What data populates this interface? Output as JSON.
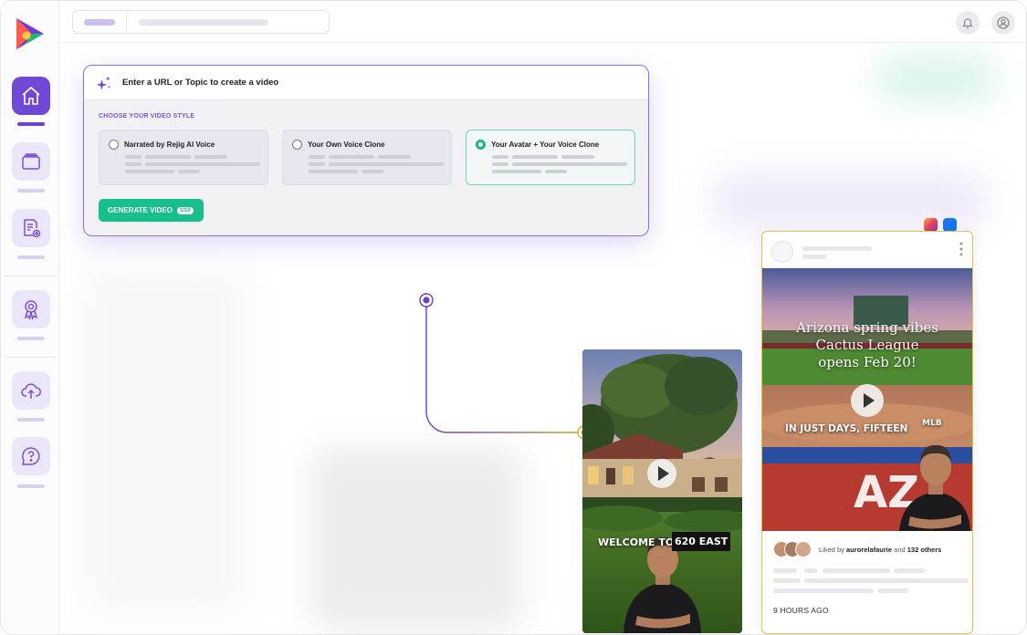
{
  "prompt": {
    "title": "Enter a URL or Topic to create a video",
    "style_label": "CHOOSE YOUR VIDEO STYLE",
    "options": [
      {
        "label": "Narrated by Rejig AI Voice",
        "selected": false
      },
      {
        "label": "Your Own Voice Clone",
        "selected": false
      },
      {
        "label": "Your Avatar + Your Voice Clone",
        "selected": true
      }
    ],
    "generate_label": "GENERATE VIDEO",
    "generate_count": "1/10"
  },
  "video": {
    "overlay_a": "WELCOME TO",
    "overlay_b": "620 EAST"
  },
  "post": {
    "caption_line1": "Arizona spring vibes",
    "caption_line2": "Cactus League",
    "caption_line3": "opens Feb 20!",
    "overlay_a": "IN JUST DAYS, FIFTEEN",
    "overlay_b": "MLB",
    "liked_prefix": "Liked by",
    "liked_user": "aurorelafaurie",
    "liked_and": "and",
    "liked_others": "132 others",
    "time": "9 HOURS AGO"
  },
  "colors": {
    "brand_purple": "#7048d6",
    "accent_green": "#17c08a",
    "post_border": "#e0c24c"
  }
}
